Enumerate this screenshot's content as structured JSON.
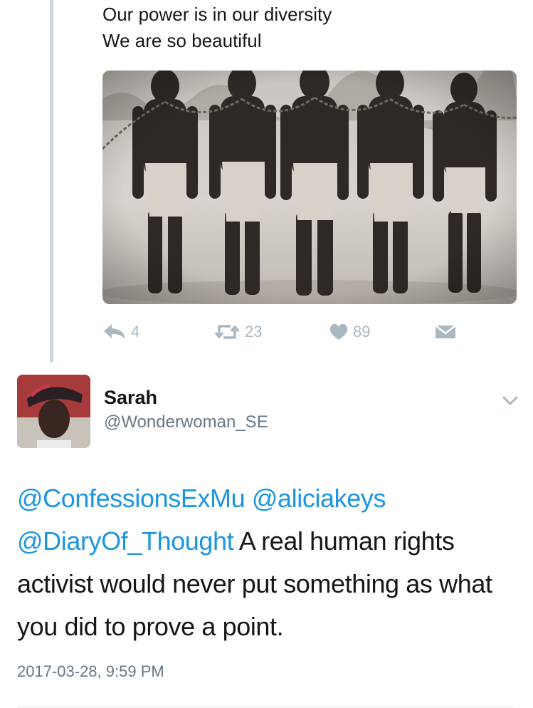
{
  "previous_tweet": {
    "text_lines": [
      "Our power is in our diversity",
      "We are so beautiful"
    ],
    "media": {
      "description_icon": "photo"
    },
    "actions": {
      "reply": {
        "icon": "reply-icon",
        "count": "4"
      },
      "retweet": {
        "icon": "retweet-icon",
        "count": "23"
      },
      "like": {
        "icon": "heart-icon",
        "count": "89"
      },
      "dm": {
        "icon": "envelope-icon"
      }
    }
  },
  "tweet": {
    "author": {
      "name": "Sarah",
      "handle": "@Wonderwoman_SE"
    },
    "text": {
      "mention1": "@ConfessionsExMu",
      "mention2": "@aliciakeys",
      "mention3": "@DiaryOf_Thought",
      "body": "A real human rights activist would never put something as what you did to prove a point."
    },
    "timestamp": "2017-03-28, 9:59 PM"
  },
  "colors": {
    "link": "#1b95e0",
    "action_gray": "#aab8c2",
    "secondary_text": "#657786",
    "thread_line": "#ccd6dd"
  }
}
